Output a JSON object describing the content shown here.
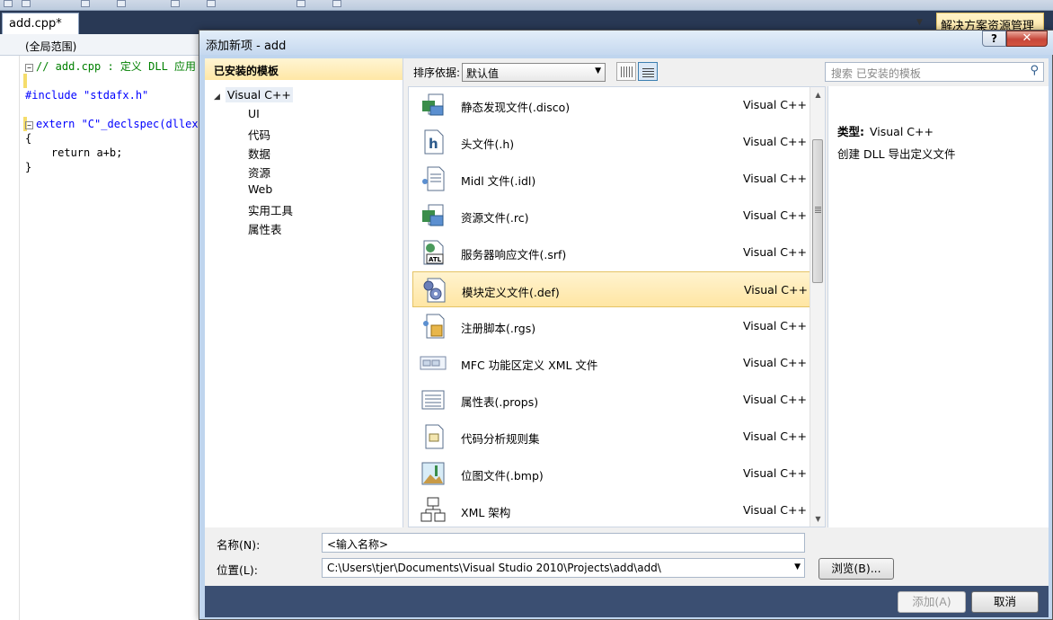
{
  "ide": {
    "doc_tab": "add.cpp*",
    "scope": "(全局范围)",
    "solution_tab": "解决方案资源管理器",
    "code_lines": [
      {
        "text": "// add.cpp : 定义 DLL 应用",
        "cls": "comment"
      },
      {
        "text": "",
        "cls": ""
      },
      {
        "text": "#include \"stdafx.h\"",
        "cls": "pp"
      },
      {
        "text": "",
        "cls": ""
      },
      {
        "text": "extern \"C\"_declspec(dllexp",
        "cls": "kw"
      },
      {
        "text": "{",
        "cls": ""
      },
      {
        "text": "    return a+b;",
        "cls": ""
      },
      {
        "text": "}",
        "cls": ""
      }
    ]
  },
  "dialog": {
    "title": "添加新项 - add",
    "help": "?",
    "close": "✕",
    "left_header": "已安装的模板",
    "tree_root": "Visual C++",
    "tree_children": [
      "UI",
      "代码",
      "数据",
      "资源",
      "Web",
      "实用工具",
      "属性表"
    ],
    "sort_label": "排序依据:",
    "sort_value": "默认值",
    "search_placeholder": "搜索 已安装的模板",
    "items": [
      {
        "name": "静态发现文件(.disco)",
        "lang": "Visual C++",
        "icon": "disco-file-icon",
        "selected": false
      },
      {
        "name": "头文件(.h)",
        "lang": "Visual C++",
        "icon": "header-file-icon",
        "selected": false
      },
      {
        "name": "Midl 文件(.idl)",
        "lang": "Visual C++",
        "icon": "midl-file-icon",
        "selected": false
      },
      {
        "name": "资源文件(.rc)",
        "lang": "Visual C++",
        "icon": "resource-file-icon",
        "selected": false
      },
      {
        "name": "服务器响应文件(.srf)",
        "lang": "Visual C++",
        "icon": "atl-file-icon",
        "selected": false
      },
      {
        "name": "模块定义文件(.def)",
        "lang": "Visual C++",
        "icon": "def-file-icon",
        "selected": true
      },
      {
        "name": "注册脚本(.rgs)",
        "lang": "Visual C++",
        "icon": "registry-script-icon",
        "selected": false
      },
      {
        "name": "MFC 功能区定义 XML 文件",
        "lang": "Visual C++",
        "icon": "ribbon-xml-icon",
        "selected": false
      },
      {
        "name": "属性表(.props)",
        "lang": "Visual C++",
        "icon": "property-sheet-icon",
        "selected": false
      },
      {
        "name": "代码分析规则集",
        "lang": "Visual C++",
        "icon": "ruleset-icon",
        "selected": false
      },
      {
        "name": "位图文件(.bmp)",
        "lang": "Visual C++",
        "icon": "bitmap-file-icon",
        "selected": false
      },
      {
        "name": "XML 架构",
        "lang": "Visual C++",
        "icon": "xml-schema-icon",
        "selected": false
      }
    ],
    "detail_type_label": "类型:",
    "detail_type_value": "Visual C++",
    "detail_description": "创建 DLL 导出定义文件",
    "name_label": "名称(N):",
    "name_value": "<输入名称>",
    "location_label": "位置(L):",
    "location_value": "C:\\Users\\tjer\\Documents\\Visual Studio 2010\\Projects\\add\\add\\",
    "browse_label": "浏览(B)...",
    "add_label": "添加(A)",
    "cancel_label": "取消"
  }
}
